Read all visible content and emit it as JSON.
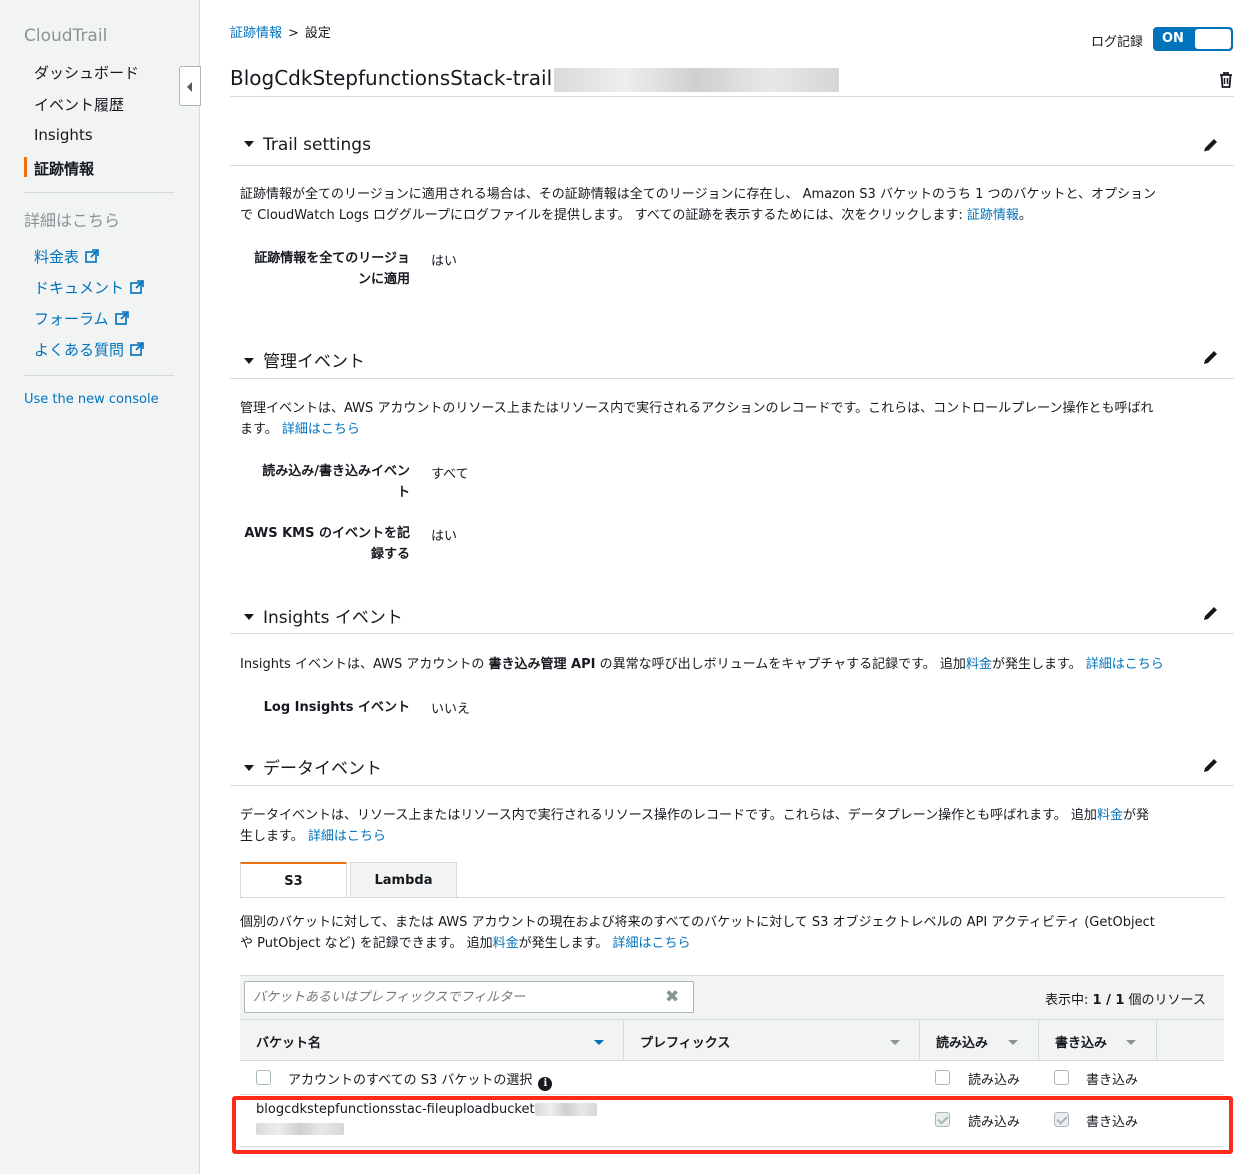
{
  "sidebar": {
    "brand": "CloudTrail",
    "items": [
      {
        "label": "ダッシュボード"
      },
      {
        "label": "イベント履歴"
      },
      {
        "label": "Insights"
      },
      {
        "label": "証跡情報"
      }
    ],
    "learn_more_heading": "詳細はこちら",
    "links": [
      {
        "label": "料金表"
      },
      {
        "label": "ドキュメント"
      },
      {
        "label": "フォーラム"
      },
      {
        "label": "よくある質問"
      }
    ],
    "new_console": "Use the new console"
  },
  "breadcrumb": {
    "parent": "証跡情報",
    "separator": ">",
    "current": "設定"
  },
  "logging": {
    "label": "ログ記録",
    "state": "ON"
  },
  "page_title": "BlogCdkStepfunctionsStack-trail",
  "sections": {
    "trail_settings": {
      "title": "Trail settings",
      "desc_line1": "証跡情報が全てのリージョンに適用される場合は、その証跡情報は全てのリージョンに存在し、 Amazon S3 バケットのうち 1 つのバケットと、オプション",
      "desc_line2": "で CloudWatch Logs ロググループにログファイルを提供します。 すべての証跡を表示するためには、次をクリックします: ",
      "desc_link": "証跡情報",
      "desc_end": "。",
      "apply_all_key_1": "証跡情報を全てのリージョ",
      "apply_all_key_2": "ンに適用",
      "apply_all_value": "はい"
    },
    "management": {
      "title": "管理イベント",
      "desc_line1": "管理イベントは、AWS アカウントのリソース上またはリソース内で実行されるアクションのレコードです。これらは、コントロールプレーン操作とも呼ばれ",
      "desc_line2": "ます。 ",
      "desc_link": "詳細はこちら",
      "rw_key_1": "読み込み/書き込みイベン",
      "rw_key_2": "ト",
      "rw_value": "すべて",
      "kms_key_1": "AWS KMS のイベントを記",
      "kms_key_2": "録する",
      "kms_value": "はい"
    },
    "insights": {
      "title": "Insights イベント",
      "desc_pre": "Insights イベントは、AWS アカウントの ",
      "desc_bold": "書き込み管理 API",
      "desc_mid": " の異常な呼び出しボリュームをキャプチャする記録です。 追加",
      "desc_link1": "料金",
      "desc_mid2": "が発生します。 ",
      "desc_link2": "詳細はこちら",
      "log_key": "Log Insights イベント",
      "log_value": "いいえ"
    },
    "data": {
      "title": "データイベント",
      "desc_line1": "データイベントは、リソース上またはリソース内で実行されるリソース操作のレコードです。これらは、データプレーン操作とも呼ばれます。 追加",
      "desc_link1": "料金",
      "desc_line1_end": "が発",
      "desc_line2": "生します。 ",
      "desc_link2": "詳細はこちら",
      "tabs": [
        {
          "label": "S3"
        },
        {
          "label": "Lambda"
        }
      ],
      "s3_desc_line1": "個別のバケットに対して、または AWS アカウントの現在および将来のすべてのバケットに対して S3 オブジェクトレベルの API アクティビティ (GetObject",
      "s3_desc_line2": "や PutObject など) を記録できます。 追加",
      "s3_desc_link1": "料金",
      "s3_desc_mid": "が発生します。 ",
      "s3_desc_link2": "詳細はこちら"
    }
  },
  "table": {
    "filter_placeholder": "バケットあるいはプレフィックスでフィルター",
    "showing_pre": "表示中: ",
    "showing_count": "1 / 1",
    "showing_post": " 個のリソース",
    "columns": [
      "バケット名",
      "プレフィックス",
      "読み込み",
      "書き込み"
    ],
    "select_all_label": "アカウントのすべての S3 バケットの選択",
    "read_label": "読み込み",
    "write_label": "書き込み",
    "rows": [
      {
        "bucket": "blogcdkstepfunctionsstac-fileuploadbucket",
        "read_checked": true,
        "write_checked": true
      }
    ]
  },
  "colors": {
    "accent": "#ec7211",
    "link": "#0073bb",
    "highlight": "#ff2a1a",
    "toggle": "#0073bb"
  }
}
